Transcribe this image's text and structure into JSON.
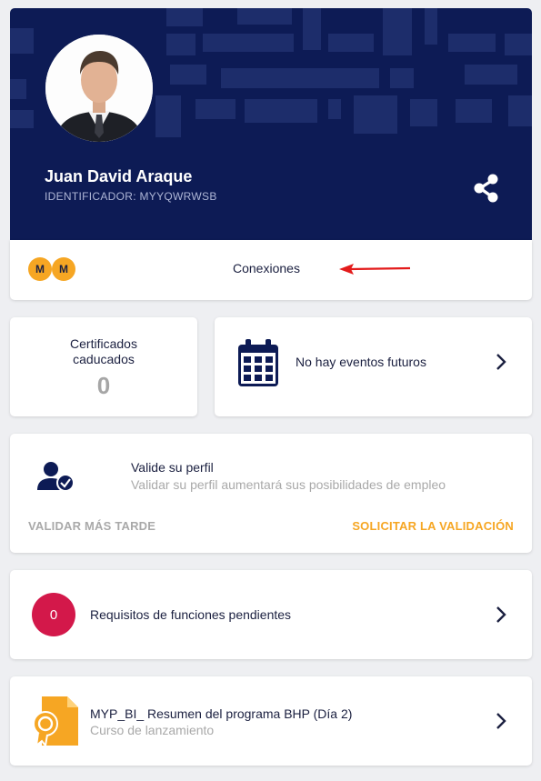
{
  "profile": {
    "name": "Juan David Araque",
    "identifier": "IDENTIFICADOR: MYYQWRWSB"
  },
  "connections": {
    "badges": [
      "M",
      "M"
    ],
    "label": "Conexiones"
  },
  "certificates": {
    "label": "Certificados caducados",
    "count": "0"
  },
  "events": {
    "label": "No hay eventos futuros"
  },
  "validation": {
    "title": "Valide su perfil",
    "subtitle": "Validar su perfil aumentará sus posibilidades de empleo",
    "later_label": "VALIDAR MÁS TARDE",
    "request_label": "SOLICITAR LA VALIDACIÓN"
  },
  "requirements": {
    "count": "0",
    "label": "Requisitos de funciones pendientes"
  },
  "course": {
    "title": "MYP_BI_ Resumen del programa BHP (Día 2)",
    "subtitle": "Curso de lanzamiento"
  },
  "colors": {
    "header_bg": "#0d1b55",
    "accent": "#f6a623",
    "danger": "#d3184a",
    "arrow": "#e31b1b"
  },
  "icons": [
    "share-icon",
    "calendar-icon",
    "user-verified-icon",
    "chevron-right-icon",
    "certificate-file-icon"
  ]
}
